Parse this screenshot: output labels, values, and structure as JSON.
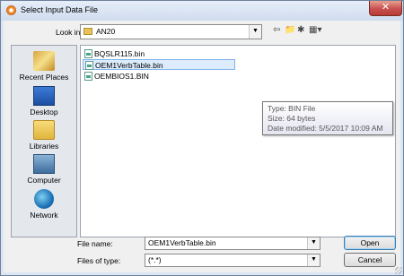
{
  "window": {
    "title": "Select Input Data File",
    "close_glyph": "✕"
  },
  "lookin": {
    "label": "Look in:",
    "value": "AN20"
  },
  "toolbar": {
    "back": "⇦",
    "up": "📁",
    "new_folder": "✱",
    "view": "▦▾"
  },
  "places": [
    {
      "label": "Recent Places",
      "icon": "recent-places-icon"
    },
    {
      "label": "Desktop",
      "icon": "desktop-icon"
    },
    {
      "label": "Libraries",
      "icon": "libraries-icon"
    },
    {
      "label": "Computer",
      "icon": "computer-icon"
    },
    {
      "label": "Network",
      "icon": "network-icon"
    }
  ],
  "files": [
    {
      "name": "BQSLR115.bin",
      "selected": false
    },
    {
      "name": "OEM1VerbTable.bin",
      "selected": true
    },
    {
      "name": "OEMBIOS1.BIN",
      "selected": false
    }
  ],
  "tooltip": {
    "type": "Type: BIN File",
    "size": "Size: 64 bytes",
    "modified": "Date modified: 5/5/2017 10:09 AM"
  },
  "filename": {
    "label": "File name:",
    "value": "OEM1VerbTable.bin"
  },
  "filetype": {
    "label": "Files of type:",
    "value": "(*.*)"
  },
  "buttons": {
    "open": "Open",
    "cancel": "Cancel"
  }
}
